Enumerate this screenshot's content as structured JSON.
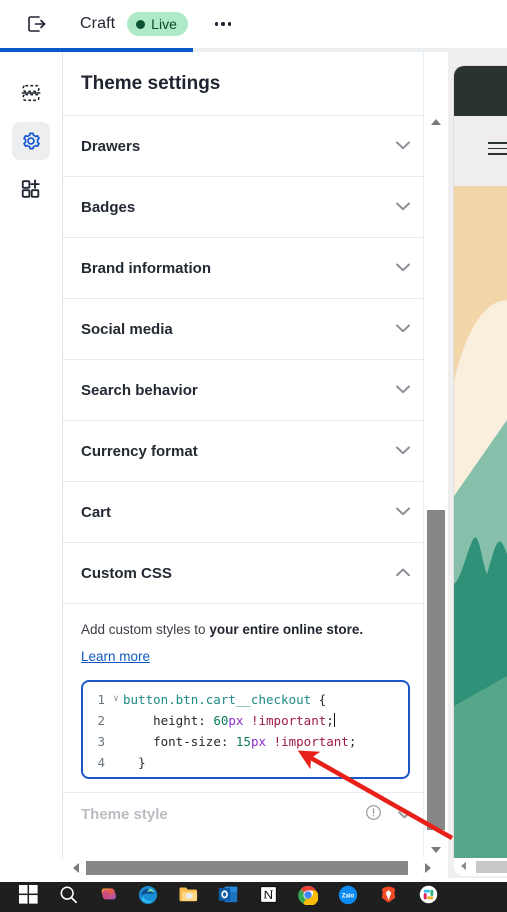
{
  "topbar": {
    "exit_icon": "exit-icon",
    "shop_name": "Craft",
    "live_label": "Live",
    "more_icon": "ellipsis-icon",
    "progress_percent": 38
  },
  "rail": {
    "items": [
      {
        "icon": "sections-icon",
        "name": "sections",
        "active": false
      },
      {
        "icon": "gear-icon",
        "name": "theme-settings",
        "active": true
      },
      {
        "icon": "app-blocks-add-icon",
        "name": "apps",
        "active": false
      }
    ]
  },
  "panel": {
    "title": "Theme settings",
    "sections": [
      {
        "label": "Drawers",
        "expanded": false
      },
      {
        "label": "Badges",
        "expanded": false
      },
      {
        "label": "Brand information",
        "expanded": false
      },
      {
        "label": "Social media",
        "expanded": false
      },
      {
        "label": "Search behavior",
        "expanded": false
      },
      {
        "label": "Currency format",
        "expanded": false
      },
      {
        "label": "Cart",
        "expanded": false
      },
      {
        "label": "Custom CSS",
        "expanded": true
      }
    ],
    "custom_css": {
      "description_plain": "Add custom styles to ",
      "description_bold": "your entire online store.",
      "learn_more": "Learn more",
      "code": {
        "lines": [
          {
            "number": "1",
            "fold": "∨",
            "selector": "button.btn.cart__checkout",
            "brace": " {"
          },
          {
            "number": "2",
            "fold": "",
            "indent": "    ",
            "property": "height:",
            "value": "60",
            "unit": "px",
            "important": " !important",
            "semi": ";",
            "caret": true
          },
          {
            "number": "3",
            "fold": "",
            "indent": "    ",
            "property": "font-size:",
            "value": "15",
            "unit": "px",
            "important": " !important",
            "semi": ";",
            "caret": false
          },
          {
            "number": "4",
            "fold": "",
            "indent": "  ",
            "close": "}"
          }
        ]
      }
    },
    "theme_style": {
      "label": "Theme style",
      "warning_icon": "warning-circle-icon",
      "chevron_icon": "chevron-down-icon"
    }
  },
  "scrollbars": {
    "vertical": {
      "up_icon": "caret-up-icon",
      "down_icon": "caret-down-icon"
    },
    "horizontal": {
      "left_icon": "caret-left-icon",
      "right_icon": "caret-right-icon"
    }
  },
  "preview": {
    "name": "storefront-preview",
    "header_color": "#2b3330",
    "nav_color": "#eeeeec",
    "menu_icon": "hamburger-icon",
    "sky_color": "#f2d5a9",
    "cloud_color": "#faefdd",
    "hill_light_color": "#86c0ab",
    "hill_dark_color": "#2f9178",
    "hill_mid_color": "#56a68a"
  },
  "annotation": {
    "arrow_color": "#e8201a",
    "name": "red-pointer-arrow"
  },
  "taskbar": {
    "items": [
      {
        "name": "start-button",
        "icon": "windows-icon"
      },
      {
        "name": "search-button",
        "icon": "search-icon"
      },
      {
        "name": "copilot-button",
        "icon": "copilot-icon"
      },
      {
        "name": "edge-button",
        "icon": "edge-icon"
      },
      {
        "name": "file-explorer-button",
        "icon": "folder-icon"
      },
      {
        "name": "outlook-button",
        "icon": "outlook-icon"
      },
      {
        "name": "notion-button",
        "icon": "notion-icon"
      },
      {
        "name": "chrome-button",
        "icon": "chrome-icon"
      },
      {
        "name": "zalo-button",
        "icon": "zalo-icon",
        "label": "Zalo"
      },
      {
        "name": "brave-button",
        "icon": "brave-icon"
      },
      {
        "name": "slack-button",
        "icon": "slack-icon"
      }
    ]
  }
}
